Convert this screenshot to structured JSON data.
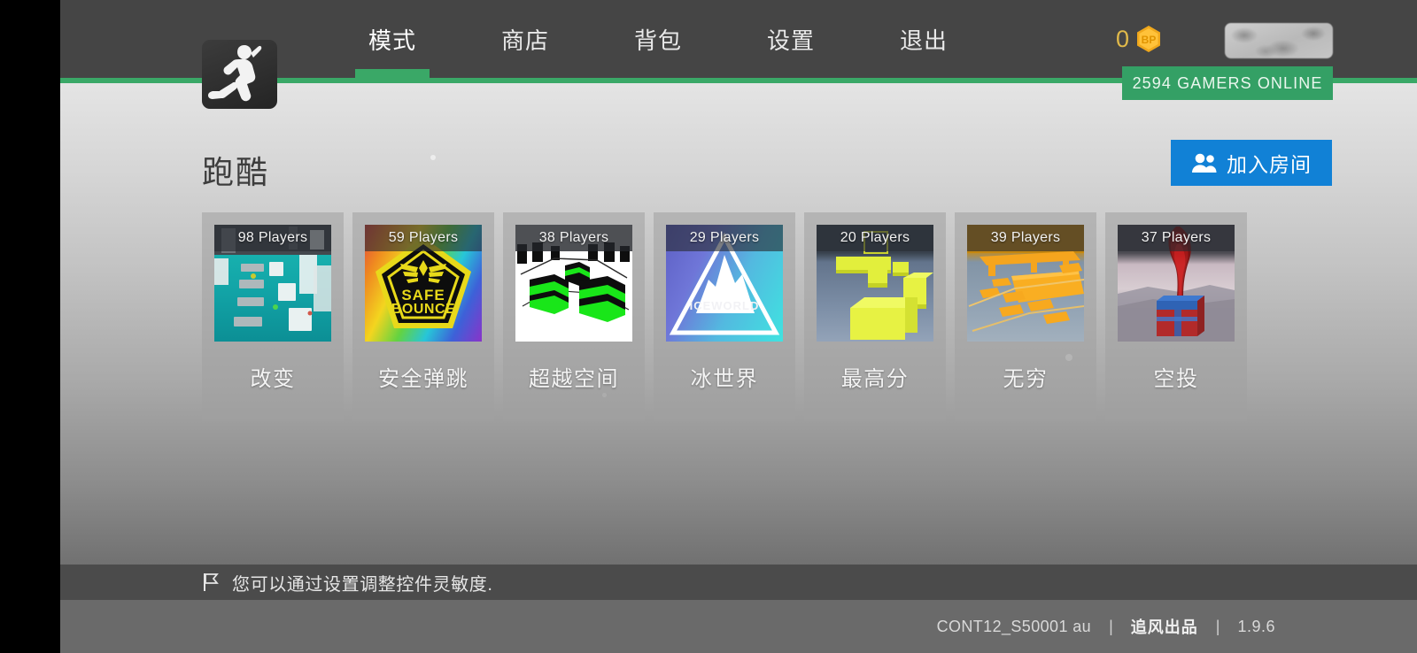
{
  "header": {
    "logo_icon": "running-man-logo",
    "nav": [
      {
        "label": "模式",
        "active": true
      },
      {
        "label": "商店",
        "active": false
      },
      {
        "label": "背包",
        "active": false
      },
      {
        "label": "设置",
        "active": false
      },
      {
        "label": "退出",
        "active": false
      }
    ],
    "currency": {
      "amount": "0",
      "icon": "bp-coin-icon",
      "color": "#e0b94a"
    },
    "profile_plate": "player-name-plate",
    "online_banner": "2594 GAMERS ONLINE",
    "accent_green": "#3aa867",
    "bar_color": "#454545"
  },
  "main": {
    "page_title": "跑酷",
    "join_button": {
      "label": "加入房间",
      "icon": "people-icon",
      "color": "#1181d6"
    },
    "cards": [
      {
        "name": "改变",
        "players": "98 Players",
        "art": "cyan-platforms"
      },
      {
        "name": "安全弹跳",
        "players": "59 Players",
        "art": "safe-bounce-badge",
        "badge_text_1": "SAFE",
        "badge_text_2": "BOUNCE"
      },
      {
        "name": "超越空间",
        "players": "38 Players",
        "art": "green-hex-platforms"
      },
      {
        "name": "冰世界",
        "players": "29 Players",
        "art": "iceworld-mountain",
        "badge_text_1": "ICEWORLD"
      },
      {
        "name": "最高分",
        "players": "20 Players",
        "art": "yellow-blocks"
      },
      {
        "name": "无穷",
        "players": "39 Players",
        "art": "orange-platforms"
      },
      {
        "name": "空投",
        "players": "37 Players",
        "art": "airdrop-crate"
      }
    ]
  },
  "tip_bar": {
    "icon": "flag-icon",
    "text": "您可以通过设置调整控件灵敏度."
  },
  "footer": {
    "session": "CONT12_S50001 au",
    "separator": "|",
    "brand": "追风出品",
    "version": "1.9.6"
  }
}
